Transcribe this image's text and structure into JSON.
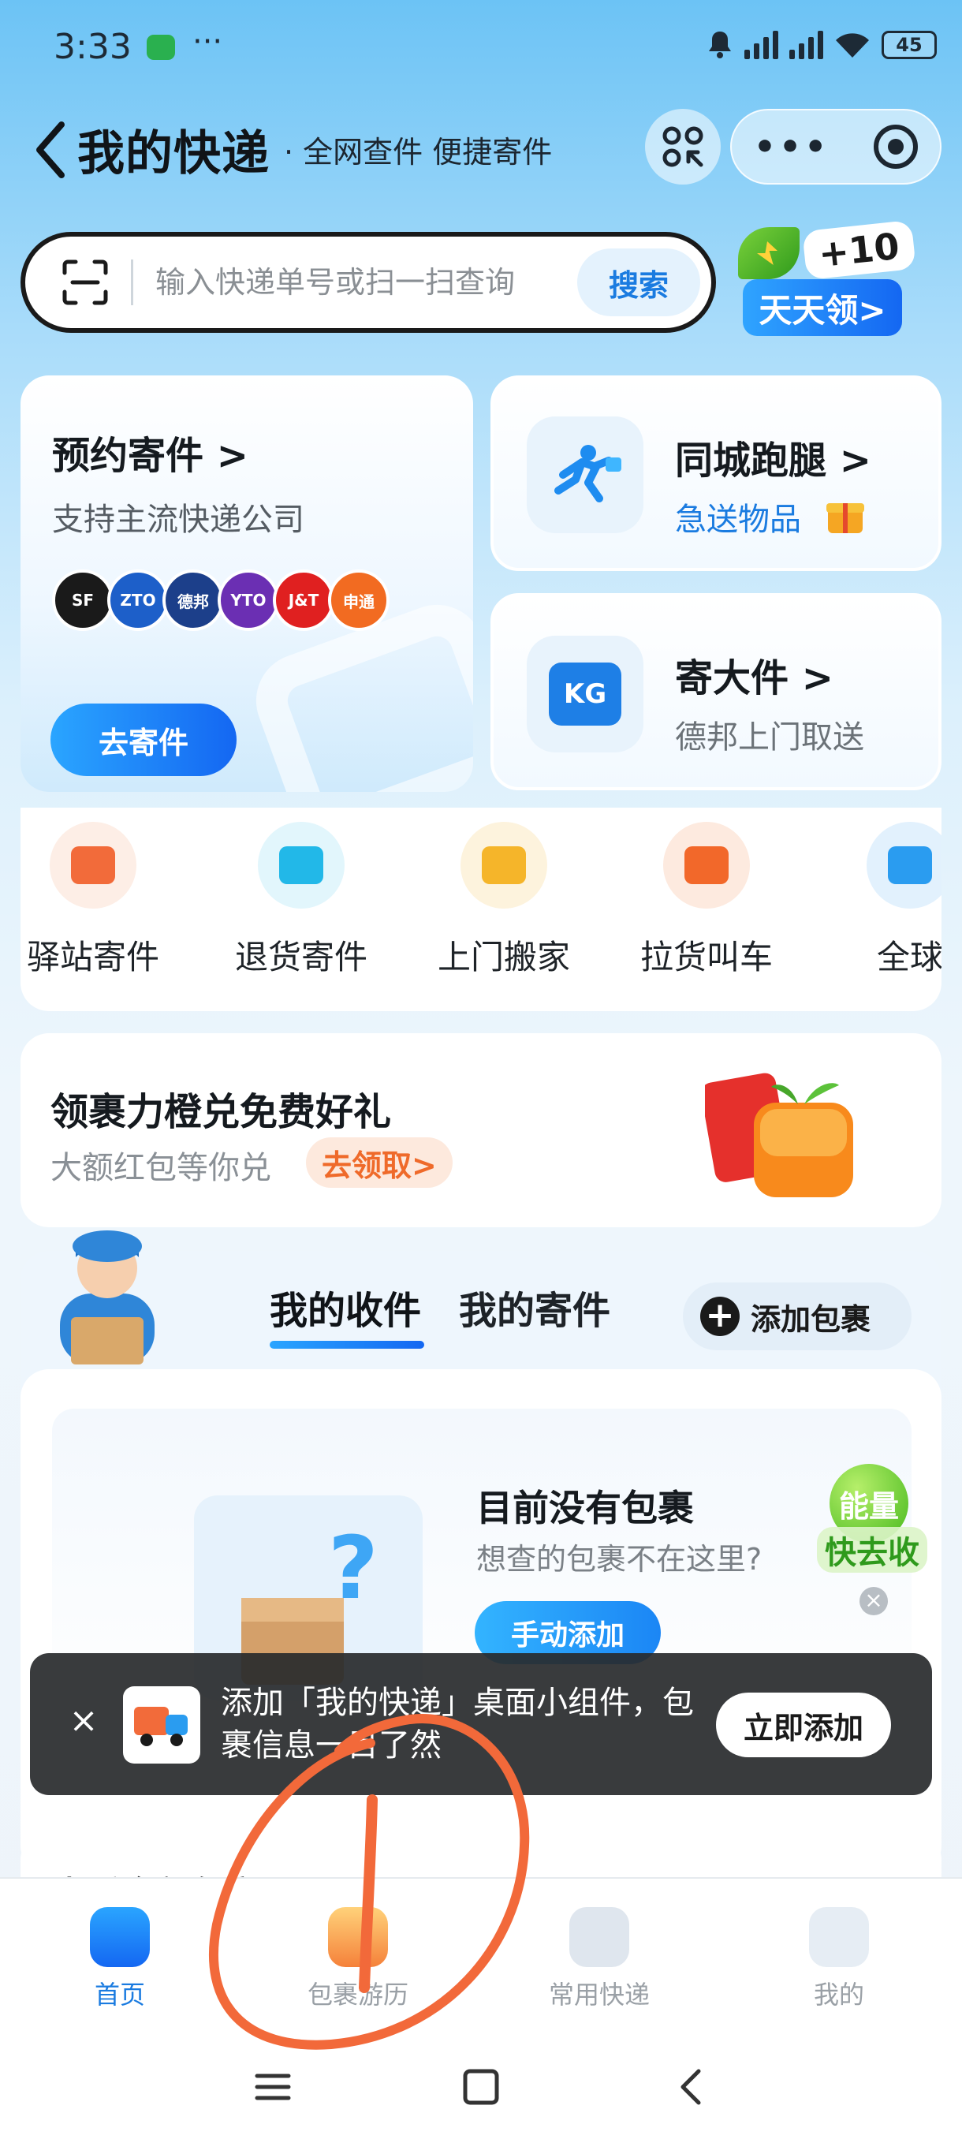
{
  "status_bar": {
    "time": "3:33",
    "more": "···",
    "battery": "45"
  },
  "header": {
    "title": "我的快递",
    "subtitle": "· 全网查件 便捷寄件"
  },
  "search": {
    "placeholder": "输入快递单号或扫一扫查询",
    "button_label": "搜索"
  },
  "reward": {
    "points": "+10",
    "label": "天天领>"
  },
  "cards": {
    "send": {
      "title": "预约寄件 >",
      "subtitle": "支持主流快递公司",
      "button_label": "去寄件",
      "brands": [
        {
          "name": "SF",
          "color": "#1a1a1a"
        },
        {
          "name": "ZTO",
          "color": "#1d5fc9"
        },
        {
          "name": "德邦",
          "color": "#1c3f8a"
        },
        {
          "name": "YTO",
          "color": "#6b2fb3"
        },
        {
          "name": "J&T",
          "color": "#e02020"
        },
        {
          "name": "申通",
          "color": "#f26b21"
        }
      ]
    },
    "runner": {
      "title": "同城跑腿 >",
      "subtitle": "急送物品"
    },
    "bulky": {
      "title": "寄大件 >",
      "subtitle": "德邦上门取送",
      "icon_text": "KG"
    }
  },
  "quick_services": [
    {
      "label": "驿站寄件",
      "color": "#f26b3a",
      "bg": "#fdeee6"
    },
    {
      "label": "退货寄件",
      "color": "#22b8e8",
      "bg": "#e2f6fc"
    },
    {
      "label": "上门搬家",
      "color": "#f5b52a",
      "bg": "#fdf3dd"
    },
    {
      "label": "拉货叫车",
      "color": "#f2682a",
      "bg": "#fdeadf"
    },
    {
      "label": "全球",
      "color": "#2a9cf0",
      "bg": "#e2f1fd"
    }
  ],
  "promo": {
    "title": "领裹力橙兑免费好礼",
    "subtitle": "大额红包等你兑",
    "cta": "去领取>"
  },
  "parcels": {
    "tab_receive": "我的收件",
    "tab_send": "我的寄件",
    "add_label": "添加包裹",
    "empty_title": "目前没有包裹",
    "empty_sub": "想查的包裹不在这里?",
    "manual_add": "手动添加",
    "energy_top": "能量",
    "energy_bottom": "快去收",
    "all_parcels": "查看全部包裹"
  },
  "toast": {
    "text": "添加「我的快递」桌面小组件，包裹信息一目了然",
    "button_label": "立即添加"
  },
  "bottom_nav": [
    {
      "label": "首页",
      "icon": "home-icon",
      "active": true
    },
    {
      "label": "包裹游历",
      "icon": "parcel-journey-icon",
      "active": false
    },
    {
      "label": "常用快递",
      "icon": "courier-icon",
      "active": false
    },
    {
      "label": "我的",
      "icon": "profile-icon",
      "active": false
    }
  ],
  "colors": {
    "accent": "#1a7be0",
    "annotation": "#f2693a"
  }
}
